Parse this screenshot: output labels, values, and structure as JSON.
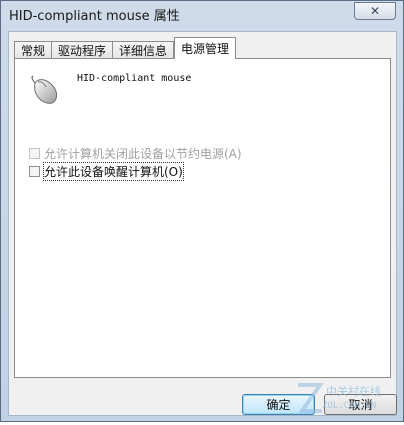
{
  "window": {
    "title": "HID-compliant mouse 属性",
    "close_glyph": "✕"
  },
  "tabs": [
    {
      "label": "常规"
    },
    {
      "label": "驱动程序"
    },
    {
      "label": "详细信息"
    },
    {
      "label": "电源管理"
    }
  ],
  "active_tab": "电源管理",
  "device": {
    "name": "HID-compliant mouse",
    "icon": "mouse-icon"
  },
  "options": {
    "allow_power_off": {
      "label": "允许计算机关闭此设备以节约电源(A)",
      "checked": false,
      "enabled": false
    },
    "allow_wake": {
      "label": "允许此设备唤醒计算机(O)",
      "checked": false,
      "enabled": true
    }
  },
  "buttons": {
    "ok": "确定",
    "cancel": "取消"
  },
  "watermark": {
    "text": "中关村在线",
    "url": "ZOL.COM.CN"
  }
}
